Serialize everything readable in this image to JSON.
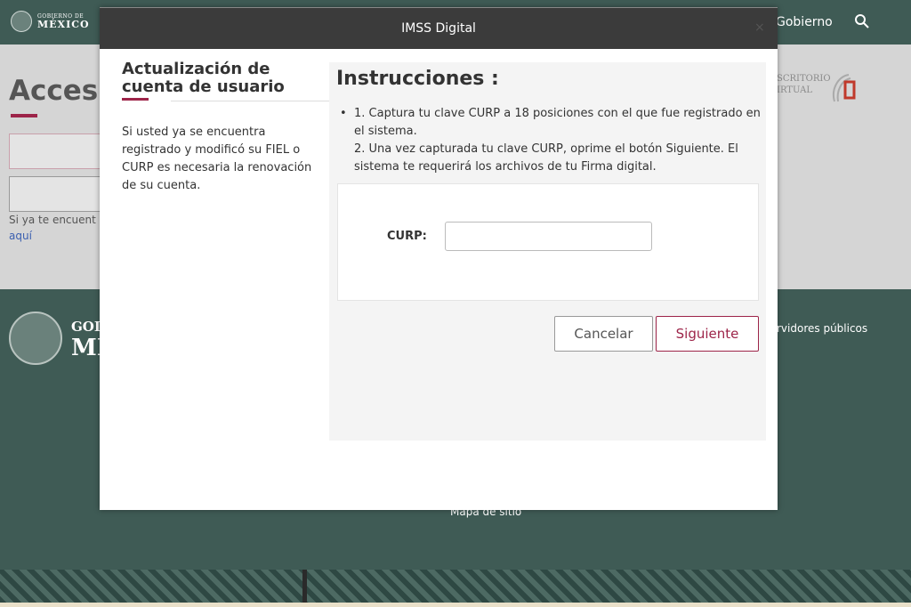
{
  "header": {
    "logo_small": "GOBIERNO DE",
    "logo_big": "MÉXICO",
    "nav_gobierno": "Gobierno"
  },
  "page": {
    "acceso_title": "Acces",
    "si_ya_text": "Si ya te encuent",
    "aqui_link": "aquí",
    "escritorio_line1": "SCRITORIO",
    "escritorio_line2": "IRTUAL"
  },
  "footer": {
    "gob_text": "GOI",
    "mx_text": "MI",
    "servidores": "rvidores públicos",
    "mapa": "Mapa de sitio"
  },
  "modal": {
    "title": "IMSS Digital",
    "close": "×",
    "left_heading_line1": "Actualización de",
    "left_heading_line2": "cuenta de usuario",
    "left_text": "Si usted ya se encuentra registrado y modificó su FIEL o CURP es necesaria la renovación de su cuenta.",
    "instructions_title": "Instrucciones :",
    "instructions": [
      "1. Captura tu clave CURP a 18 posiciones con el que fue registrado en el sistema.",
      "2. Una vez capturada tu clave CURP, oprime el botón Siguiente. El sistema te requerirá los archivos de tu Firma digital."
    ],
    "curp_label": "CURP:",
    "curp_value": "",
    "cancel_label": "Cancelar",
    "next_label": "Siguiente"
  },
  "colors": {
    "accent": "#9d2449",
    "header_bg": "#3b3b3b",
    "page_green": "#3f5b55"
  }
}
